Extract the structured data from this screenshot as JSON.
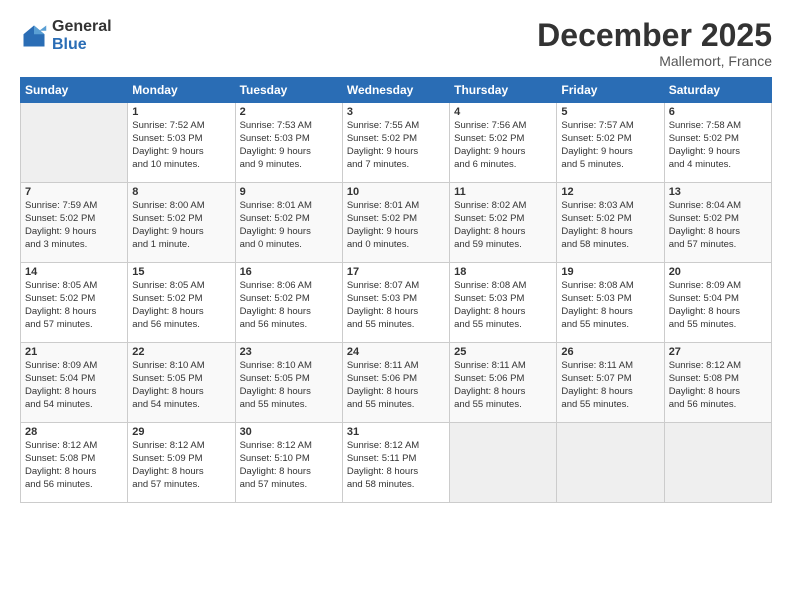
{
  "logo": {
    "general": "General",
    "blue": "Blue"
  },
  "title": "December 2025",
  "subtitle": "Mallemort, France",
  "days_header": [
    "Sunday",
    "Monday",
    "Tuesday",
    "Wednesday",
    "Thursday",
    "Friday",
    "Saturday"
  ],
  "weeks": [
    [
      {
        "day": "",
        "empty": true
      },
      {
        "day": "1",
        "lines": [
          "Sunrise: 7:52 AM",
          "Sunset: 5:03 PM",
          "Daylight: 9 hours",
          "and 10 minutes."
        ]
      },
      {
        "day": "2",
        "lines": [
          "Sunrise: 7:53 AM",
          "Sunset: 5:03 PM",
          "Daylight: 9 hours",
          "and 9 minutes."
        ]
      },
      {
        "day": "3",
        "lines": [
          "Sunrise: 7:55 AM",
          "Sunset: 5:02 PM",
          "Daylight: 9 hours",
          "and 7 minutes."
        ]
      },
      {
        "day": "4",
        "lines": [
          "Sunrise: 7:56 AM",
          "Sunset: 5:02 PM",
          "Daylight: 9 hours",
          "and 6 minutes."
        ]
      },
      {
        "day": "5",
        "lines": [
          "Sunrise: 7:57 AM",
          "Sunset: 5:02 PM",
          "Daylight: 9 hours",
          "and 5 minutes."
        ]
      },
      {
        "day": "6",
        "lines": [
          "Sunrise: 7:58 AM",
          "Sunset: 5:02 PM",
          "Daylight: 9 hours",
          "and 4 minutes."
        ]
      }
    ],
    [
      {
        "day": "7",
        "lines": [
          "Sunrise: 7:59 AM",
          "Sunset: 5:02 PM",
          "Daylight: 9 hours",
          "and 3 minutes."
        ]
      },
      {
        "day": "8",
        "lines": [
          "Sunrise: 8:00 AM",
          "Sunset: 5:02 PM",
          "Daylight: 9 hours",
          "and 1 minute."
        ]
      },
      {
        "day": "9",
        "lines": [
          "Sunrise: 8:01 AM",
          "Sunset: 5:02 PM",
          "Daylight: 9 hours",
          "and 0 minutes."
        ]
      },
      {
        "day": "10",
        "lines": [
          "Sunrise: 8:01 AM",
          "Sunset: 5:02 PM",
          "Daylight: 9 hours",
          "and 0 minutes."
        ]
      },
      {
        "day": "11",
        "lines": [
          "Sunrise: 8:02 AM",
          "Sunset: 5:02 PM",
          "Daylight: 8 hours",
          "and 59 minutes."
        ]
      },
      {
        "day": "12",
        "lines": [
          "Sunrise: 8:03 AM",
          "Sunset: 5:02 PM",
          "Daylight: 8 hours",
          "and 58 minutes."
        ]
      },
      {
        "day": "13",
        "lines": [
          "Sunrise: 8:04 AM",
          "Sunset: 5:02 PM",
          "Daylight: 8 hours",
          "and 57 minutes."
        ]
      }
    ],
    [
      {
        "day": "14",
        "lines": [
          "Sunrise: 8:05 AM",
          "Sunset: 5:02 PM",
          "Daylight: 8 hours",
          "and 57 minutes."
        ]
      },
      {
        "day": "15",
        "lines": [
          "Sunrise: 8:05 AM",
          "Sunset: 5:02 PM",
          "Daylight: 8 hours",
          "and 56 minutes."
        ]
      },
      {
        "day": "16",
        "lines": [
          "Sunrise: 8:06 AM",
          "Sunset: 5:02 PM",
          "Daylight: 8 hours",
          "and 56 minutes."
        ]
      },
      {
        "day": "17",
        "lines": [
          "Sunrise: 8:07 AM",
          "Sunset: 5:03 PM",
          "Daylight: 8 hours",
          "and 55 minutes."
        ]
      },
      {
        "day": "18",
        "lines": [
          "Sunrise: 8:08 AM",
          "Sunset: 5:03 PM",
          "Daylight: 8 hours",
          "and 55 minutes."
        ]
      },
      {
        "day": "19",
        "lines": [
          "Sunrise: 8:08 AM",
          "Sunset: 5:03 PM",
          "Daylight: 8 hours",
          "and 55 minutes."
        ]
      },
      {
        "day": "20",
        "lines": [
          "Sunrise: 8:09 AM",
          "Sunset: 5:04 PM",
          "Daylight: 8 hours",
          "and 55 minutes."
        ]
      }
    ],
    [
      {
        "day": "21",
        "lines": [
          "Sunrise: 8:09 AM",
          "Sunset: 5:04 PM",
          "Daylight: 8 hours",
          "and 54 minutes."
        ]
      },
      {
        "day": "22",
        "lines": [
          "Sunrise: 8:10 AM",
          "Sunset: 5:05 PM",
          "Daylight: 8 hours",
          "and 54 minutes."
        ]
      },
      {
        "day": "23",
        "lines": [
          "Sunrise: 8:10 AM",
          "Sunset: 5:05 PM",
          "Daylight: 8 hours",
          "and 55 minutes."
        ]
      },
      {
        "day": "24",
        "lines": [
          "Sunrise: 8:11 AM",
          "Sunset: 5:06 PM",
          "Daylight: 8 hours",
          "and 55 minutes."
        ]
      },
      {
        "day": "25",
        "lines": [
          "Sunrise: 8:11 AM",
          "Sunset: 5:06 PM",
          "Daylight: 8 hours",
          "and 55 minutes."
        ]
      },
      {
        "day": "26",
        "lines": [
          "Sunrise: 8:11 AM",
          "Sunset: 5:07 PM",
          "Daylight: 8 hours",
          "and 55 minutes."
        ]
      },
      {
        "day": "27",
        "lines": [
          "Sunrise: 8:12 AM",
          "Sunset: 5:08 PM",
          "Daylight: 8 hours",
          "and 56 minutes."
        ]
      }
    ],
    [
      {
        "day": "28",
        "lines": [
          "Sunrise: 8:12 AM",
          "Sunset: 5:08 PM",
          "Daylight: 8 hours",
          "and 56 minutes."
        ]
      },
      {
        "day": "29",
        "lines": [
          "Sunrise: 8:12 AM",
          "Sunset: 5:09 PM",
          "Daylight: 8 hours",
          "and 57 minutes."
        ]
      },
      {
        "day": "30",
        "lines": [
          "Sunrise: 8:12 AM",
          "Sunset: 5:10 PM",
          "Daylight: 8 hours",
          "and 57 minutes."
        ]
      },
      {
        "day": "31",
        "lines": [
          "Sunrise: 8:12 AM",
          "Sunset: 5:11 PM",
          "Daylight: 8 hours",
          "and 58 minutes."
        ]
      },
      {
        "day": "",
        "empty": true
      },
      {
        "day": "",
        "empty": true
      },
      {
        "day": "",
        "empty": true
      }
    ]
  ]
}
